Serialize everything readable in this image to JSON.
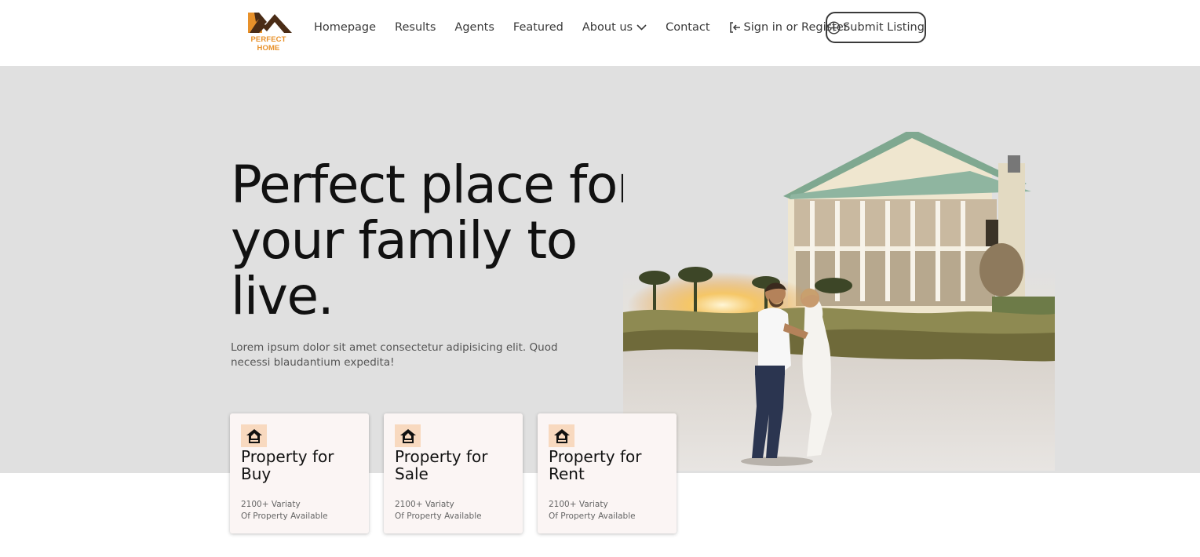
{
  "brand": {
    "name": "PERFECT HOME",
    "accent": "#e8912a",
    "dark": "#4a2c16"
  },
  "nav": {
    "items": [
      {
        "label": "Homepage"
      },
      {
        "label": "Results"
      },
      {
        "label": "Agents"
      },
      {
        "label": "Featured"
      },
      {
        "label": "About us",
        "icon": "chevron-down-icon"
      },
      {
        "label": "Contact"
      }
    ],
    "signin": {
      "label": "Sign in or Register",
      "icon": "sign-in-icon"
    },
    "submit": {
      "label": "Submit Listing",
      "icon": "plus-circle-icon"
    }
  },
  "hero": {
    "title": "Perfect place for your family to live.",
    "description": "Lorem ipsum dolor sit amet consectetur adipisicing elit. Quod necessi blaudantium expedita!",
    "background": "#e0e0e0",
    "image": "couple on beach in front of beach house at sunset"
  },
  "cards": [
    {
      "title": "Property for Buy",
      "line1": "2100+ Variaty",
      "line2": "Of Property Available",
      "icon": "house-icon"
    },
    {
      "title": "Property for Sale",
      "line1": "2100+ Variaty",
      "line2": "Of Property Available",
      "icon": "house-icon"
    },
    {
      "title": "Property for Rent",
      "line1": "2100+ Variaty",
      "line2": "Of Property Available",
      "icon": "house-icon"
    }
  ],
  "colors": {
    "card_bg": "#fbf5f4",
    "icon_bg": "#f8d9bf"
  }
}
